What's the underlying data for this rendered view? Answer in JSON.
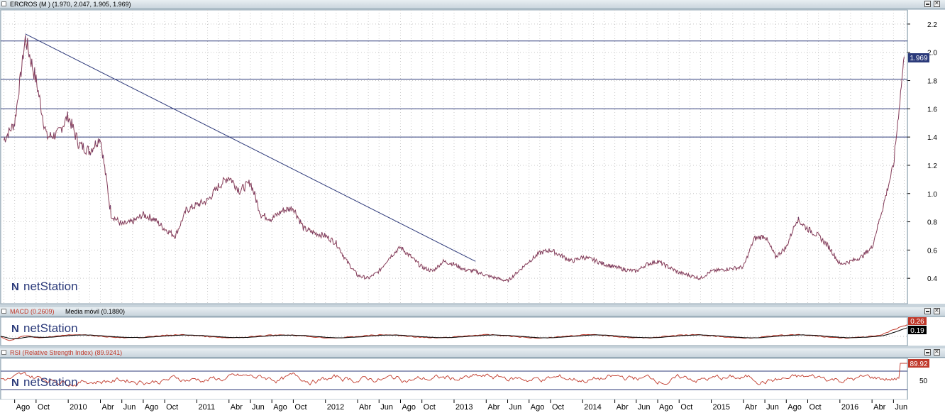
{
  "brand": {
    "logo_text": "netStation"
  },
  "price_panel": {
    "title": "ERCROS (M ) (1.970, 2.047, 1.905, 1.969)",
    "last_value_badge": "1.969",
    "y_ticks": [
      "2.2",
      "2.0",
      "1.8",
      "1.6",
      "1.4",
      "1.2",
      "1.0",
      "0.8",
      "0.6",
      "0.4"
    ]
  },
  "macd_panel": {
    "title_macd": "MACD (0.2609)",
    "title_signal": "Media móvil (0.1880)",
    "badge_macd": "0.26",
    "badge_signal": "0.19"
  },
  "rsi_panel": {
    "title": "RSI (Relative Strength Index) (89.9241)",
    "badge": "89.92",
    "y_tick": "50"
  },
  "x_axis_labels": [
    "Ago",
    "Oct",
    "2010",
    "Abr",
    "Jun",
    "Ago",
    "Oct",
    "2011",
    "Abr",
    "Jun",
    "Ago",
    "Oct",
    "2012",
    "Abr",
    "Jun",
    "Ago",
    "Oct",
    "2013",
    "Abr",
    "Jun",
    "Ago",
    "Oct",
    "2014",
    "Abr",
    "Jun",
    "Ago",
    "Oct",
    "2015",
    "Abr",
    "Jun",
    "Ago",
    "Oct",
    "2016",
    "Abr",
    "Jun"
  ],
  "chart_data": [
    {
      "type": "line",
      "title": "ERCROS (M ) (1.970, 2.047, 1.905, 1.969)",
      "ylim": [
        0.22,
        2.3
      ],
      "y_ticks": [
        2.2,
        2.0,
        1.8,
        1.6,
        1.4,
        1.2,
        1.0,
        0.8,
        0.6,
        0.4
      ],
      "horizontal_lines": [
        2.08,
        1.81,
        1.6,
        1.4
      ],
      "trendline": {
        "from": {
          "x": "2009-09",
          "y": 2.13
        },
        "to": {
          "x": "2013-03",
          "y": 0.52
        }
      },
      "series": [
        {
          "color": "#c0392b",
          "x": [
            "2009-07",
            "2009-08",
            "2009-09",
            "2009-10",
            "2009-11",
            "2009-12",
            "2010-01",
            "2010-02",
            "2010-03",
            "2010-04",
            "2010-05",
            "2010-06",
            "2010-07",
            "2010-08",
            "2010-09",
            "2010-10",
            "2010-11",
            "2010-12",
            "2011-01",
            "2011-02",
            "2011-03",
            "2011-04",
            "2011-05",
            "2011-06",
            "2011-07",
            "2011-08",
            "2011-09",
            "2011-10",
            "2011-11",
            "2011-12",
            "2012-01",
            "2012-02",
            "2012-03",
            "2012-04",
            "2012-05",
            "2012-06",
            "2012-07",
            "2012-08",
            "2012-09",
            "2012-10",
            "2012-11",
            "2012-12",
            "2013-01",
            "2013-02",
            "2013-03",
            "2013-04",
            "2013-05",
            "2013-06",
            "2013-07",
            "2013-08",
            "2013-09",
            "2013-10",
            "2013-11",
            "2013-12",
            "2014-01",
            "2014-02",
            "2014-03",
            "2014-04",
            "2014-05",
            "2014-06",
            "2014-07",
            "2014-08",
            "2014-09",
            "2014-10",
            "2014-11",
            "2014-12",
            "2015-01",
            "2015-02",
            "2015-03",
            "2015-04",
            "2015-05",
            "2015-06",
            "2015-07",
            "2015-08",
            "2015-09",
            "2015-10",
            "2015-11",
            "2015-12",
            "2016-01",
            "2016-02",
            "2016-03",
            "2016-04",
            "2016-05",
            "2016-06",
            "2016-07"
          ],
          "values": [
            1.38,
            1.5,
            2.1,
            1.8,
            1.4,
            1.42,
            1.55,
            1.35,
            1.3,
            1.4,
            0.85,
            0.78,
            0.8,
            0.85,
            0.82,
            0.75,
            0.7,
            0.88,
            0.92,
            0.95,
            1.05,
            1.12,
            1.02,
            1.08,
            0.85,
            0.82,
            0.88,
            0.9,
            0.75,
            0.72,
            0.7,
            0.65,
            0.52,
            0.42,
            0.4,
            0.45,
            0.55,
            0.62,
            0.55,
            0.48,
            0.45,
            0.52,
            0.5,
            0.46,
            0.45,
            0.42,
            0.4,
            0.38,
            0.45,
            0.52,
            0.58,
            0.6,
            0.56,
            0.52,
            0.55,
            0.53,
            0.5,
            0.48,
            0.46,
            0.45,
            0.5,
            0.52,
            0.48,
            0.44,
            0.42,
            0.4,
            0.45,
            0.46,
            0.47,
            0.48,
            0.68,
            0.7,
            0.55,
            0.62,
            0.82,
            0.75,
            0.7,
            0.62,
            0.5,
            0.52,
            0.55,
            0.62,
            0.9,
            1.2,
            1.97
          ]
        }
      ]
    },
    {
      "type": "line",
      "title": "MACD (0.2609)",
      "series": [
        {
          "name": "MACD (0.2609)",
          "color": "#c0392b",
          "last": 0.2609
        },
        {
          "name": "Media móvil (0.1880)",
          "color": "#000000",
          "last": 0.188
        }
      ]
    },
    {
      "type": "line",
      "title": "RSI (Relative Strength Index) (89.9241)",
      "ylim": [
        0,
        100
      ],
      "y_ticks": [
        50
      ],
      "horizontal_lines": [
        70,
        30
      ],
      "series": [
        {
          "color": "#c0392b",
          "last": 89.9241
        }
      ]
    }
  ]
}
